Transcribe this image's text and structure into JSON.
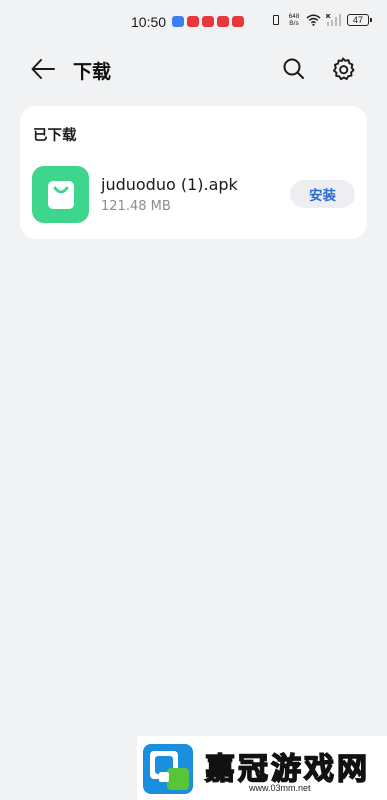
{
  "status_bar": {
    "time": "10:50",
    "net_speed_value": "648",
    "net_speed_unit": "B/s",
    "battery": "47",
    "notification_colors": [
      "#3d7ef0",
      "#e8383d",
      "#e8383d",
      "#e8383d",
      "#e8383d"
    ]
  },
  "header": {
    "title": "下载",
    "back_icon": "back-arrow-icon",
    "search_icon": "search-icon",
    "settings_icon": "gear-icon"
  },
  "downloaded_section": {
    "title": "已下载",
    "items": [
      {
        "file_name": "juduoduo (1).apk",
        "file_size": "121.48 MB",
        "action_label": "安装",
        "icon": "shopping-bag-icon",
        "icon_color": "#3dd68c"
      }
    ]
  },
  "watermark": {
    "brand": "嘉冠游戏网",
    "url": "www.03mm.net"
  },
  "colors": {
    "background": "#f1f2f4",
    "card": "#ffffff",
    "accent": "#2a6bd1",
    "secondary_text": "#8c8d90"
  }
}
